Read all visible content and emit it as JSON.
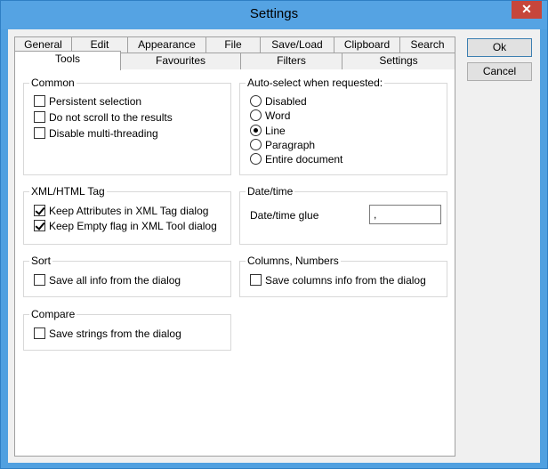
{
  "window": {
    "title": "Settings",
    "close_glyph": "✕"
  },
  "tabs_row1": [
    "General",
    "Edit",
    "Appearance",
    "File",
    "Save/Load",
    "Clipboard",
    "Search"
  ],
  "tabs_row2": [
    "Tools",
    "Favourites",
    "Filters",
    "Settings"
  ],
  "active_tab": "Tools",
  "buttons": {
    "ok": "Ok",
    "cancel": "Cancel"
  },
  "groups": {
    "common": {
      "label": "Common",
      "options": [
        {
          "label": "Persistent selection",
          "checked": false
        },
        {
          "label": "Do not scroll to the results",
          "checked": false
        },
        {
          "label": "Disable multi-threading",
          "checked": false
        }
      ]
    },
    "autoselect": {
      "label": "Auto-select when requested:",
      "options": [
        {
          "label": "Disabled",
          "selected": false
        },
        {
          "label": "Word",
          "selected": false
        },
        {
          "label": "Line",
          "selected": true
        },
        {
          "label": "Paragraph",
          "selected": false
        },
        {
          "label": "Entire document",
          "selected": false
        }
      ]
    },
    "xmltag": {
      "label": "XML/HTML Tag",
      "options": [
        {
          "label": "Keep Attributes in XML Tag dialog",
          "checked": true
        },
        {
          "label": "Keep Empty flag in XML Tool dialog",
          "checked": true
        }
      ]
    },
    "datetime": {
      "label": "Date/time",
      "glue_label": "Date/time glue",
      "glue_value": ","
    },
    "sort": {
      "label": "Sort",
      "options": [
        {
          "label": "Save all info from the dialog",
          "checked": false
        }
      ]
    },
    "columns": {
      "label": "Columns, Numbers",
      "options": [
        {
          "label": "Save columns info from the dialog",
          "checked": false
        }
      ]
    },
    "compare": {
      "label": "Compare",
      "options": [
        {
          "label": "Save strings from the dialog",
          "checked": false
        }
      ]
    }
  }
}
